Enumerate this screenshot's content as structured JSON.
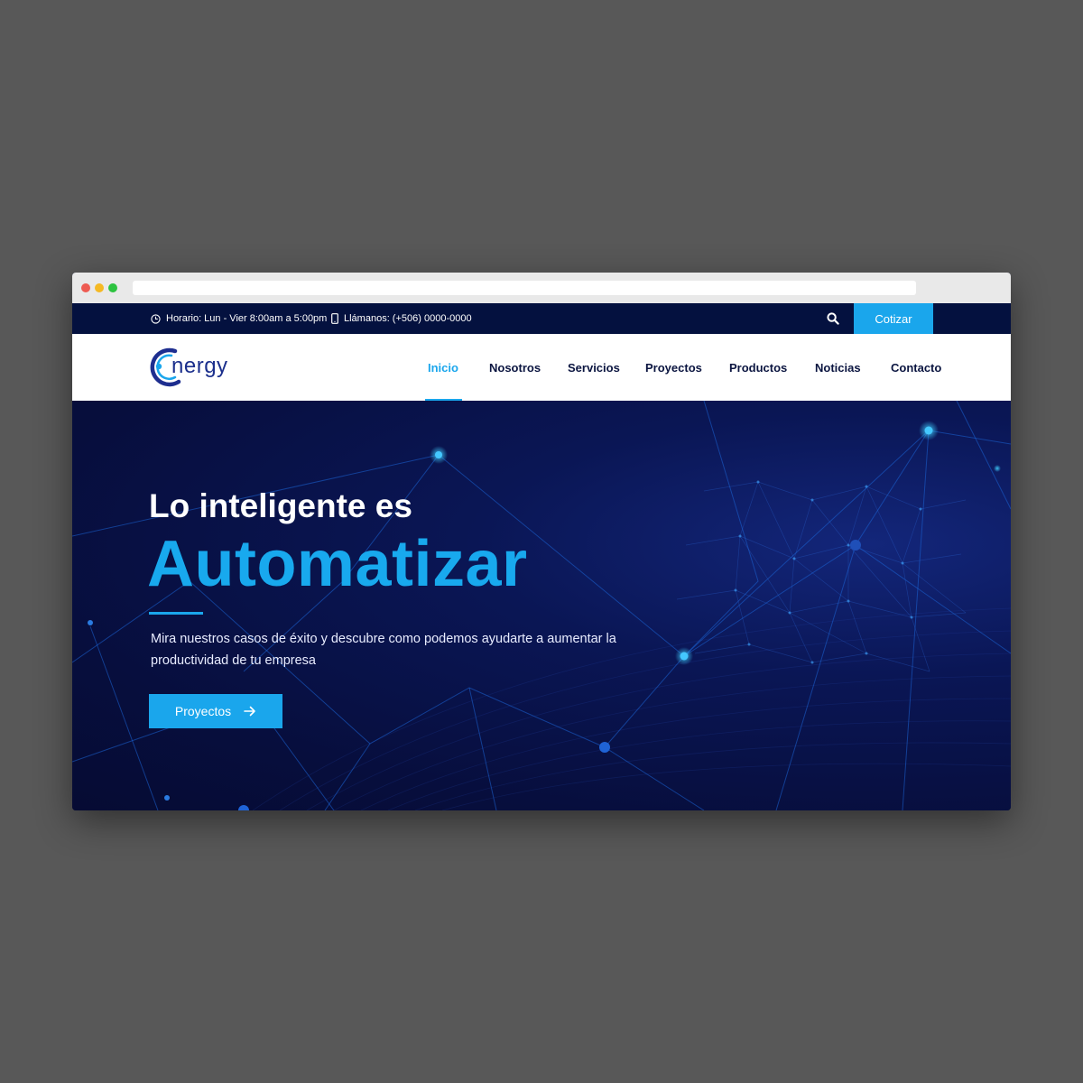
{
  "topbar": {
    "hours": "Horario: Lun - Vier  8:00am a 5:00pm",
    "phone": "Llámanos: (+506) 0000-0000",
    "quote_button": "Cotizar"
  },
  "logo": {
    "text": "nergy"
  },
  "nav": {
    "items": [
      {
        "label": "Inicio",
        "active": true
      },
      {
        "label": "Nosotros",
        "active": false
      },
      {
        "label": "Servicios",
        "active": false
      },
      {
        "label": "Proyectos",
        "active": false
      },
      {
        "label": "Productos",
        "active": false
      },
      {
        "label": "Noticias",
        "active": false
      },
      {
        "label": "Contacto",
        "active": false
      }
    ]
  },
  "hero": {
    "line1": "Lo inteligente es",
    "line2": "Automatizar",
    "description": "Mira nuestros casos de éxito y descubre como podemos ayudarte a aumentar la productividad de tu empresa",
    "cta_label": "Proyectos"
  },
  "icons": {
    "clock": "clock-icon",
    "phone": "phone-icon",
    "search": "search-icon",
    "arrow": "arrow-right-icon"
  },
  "colors": {
    "page_bg": "#585858",
    "topbar_bg": "#04113f",
    "accent": "#1aa6ec",
    "hero_bg": "#070e3d",
    "nav_text": "#0b1540"
  }
}
